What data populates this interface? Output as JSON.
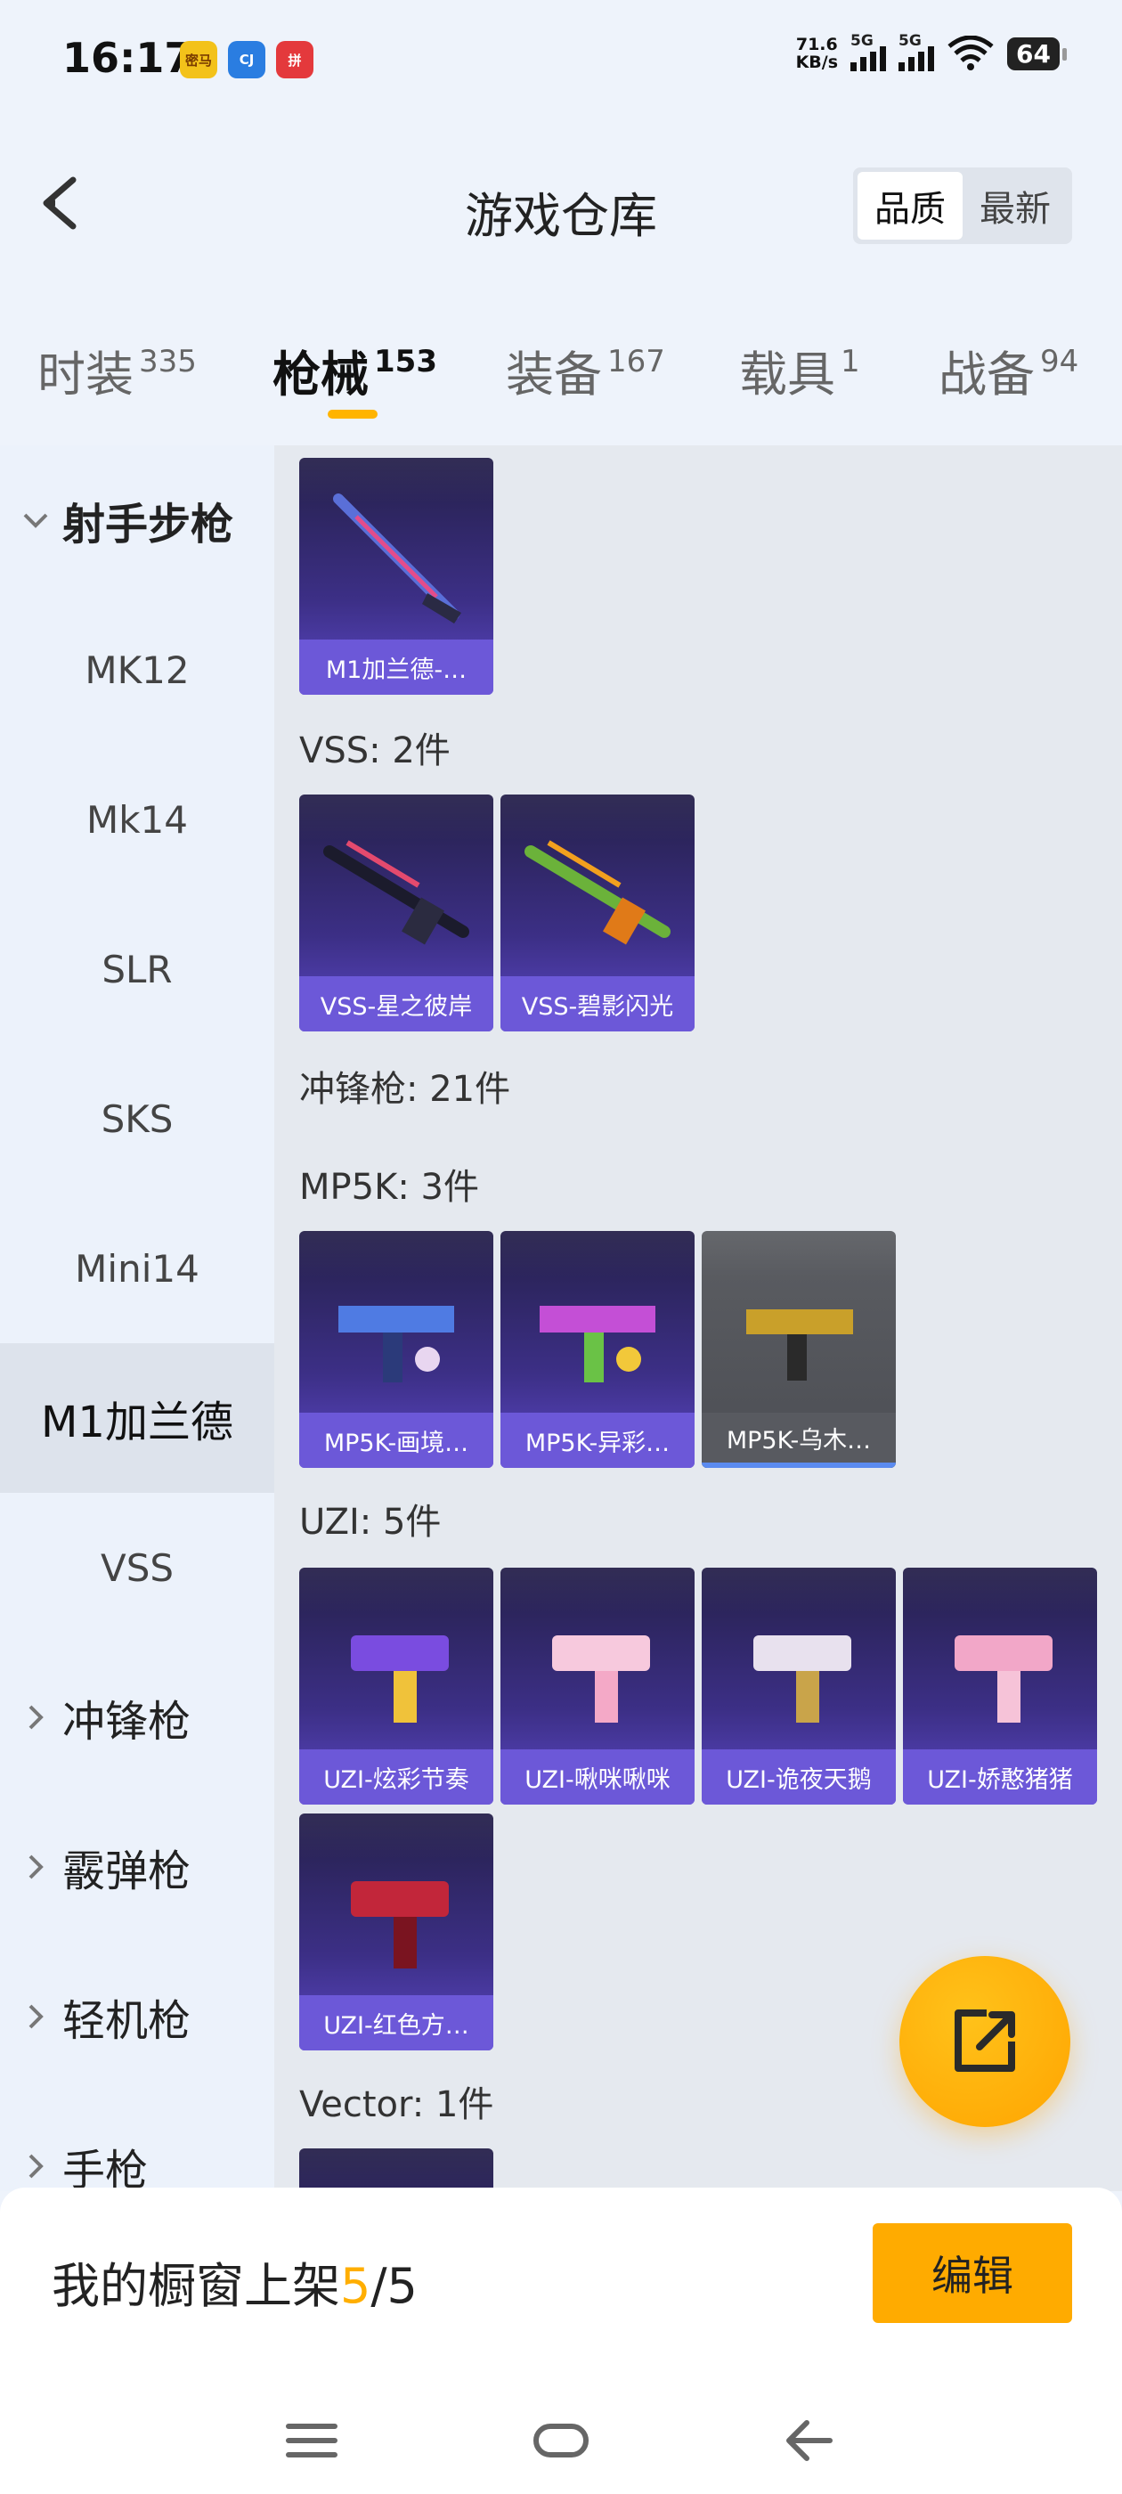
{
  "status_bar": {
    "time": "16:17",
    "apps": [
      {
        "icon": "app-icon-yellow",
        "label": "密马",
        "color": "#f3c21a"
      },
      {
        "icon": "app-icon-blue",
        "label": "CJ",
        "color": "#2a7de1"
      },
      {
        "icon": "app-icon-red",
        "label": "拼",
        "color": "#e4393c"
      }
    ],
    "net_speed": "71.6",
    "net_unit": "KB/s",
    "sig1": "5G",
    "sig2": "5G",
    "battery": "64"
  },
  "header": {
    "title": "游戏仓库",
    "sort_options": [
      "品质",
      "最新"
    ],
    "sort_active": "品质"
  },
  "tabs": [
    {
      "label": "时装",
      "count": "335"
    },
    {
      "label": "枪械",
      "count": "153",
      "active": true
    },
    {
      "label": "装备",
      "count": "167"
    },
    {
      "label": "载具",
      "count": "1"
    },
    {
      "label": "战备",
      "count": "94"
    }
  ],
  "sidebar": {
    "items": [
      {
        "label": "射手步枪",
        "type": "group",
        "open": true
      },
      {
        "label": "MK12"
      },
      {
        "label": "Mk14"
      },
      {
        "label": "SLR"
      },
      {
        "label": "SKS"
      },
      {
        "label": "Mini14"
      },
      {
        "label": "M1加兰德",
        "active": true
      },
      {
        "label": "VSS"
      },
      {
        "label": "冲锋枪",
        "type": "group"
      },
      {
        "label": "霰弹枪",
        "type": "group"
      },
      {
        "label": "轻机枪",
        "type": "group"
      },
      {
        "label": "手枪",
        "type": "group"
      }
    ]
  },
  "main": {
    "labels": {
      "vss": "VSS: 2件",
      "smg": "冲锋枪: 21件",
      "mp5k": "MP5K: 3件",
      "uzi": "UZI: 5件",
      "vector": "Vector: 1件"
    },
    "m1_items": [
      "M1加兰德-…"
    ],
    "vss_items": [
      "VSS-星之彼岸",
      "VSS-碧影闪光"
    ],
    "mp5k_items": [
      "MP5K-画境…",
      "MP5K-异彩…",
      "MP5K-乌木…"
    ],
    "uzi_items": [
      "UZI-炫彩节奏",
      "UZI-啾咪啾咪",
      "UZI-诡夜天鹅",
      "UZI-娇憨猪猪",
      "UZI-红色方…"
    ]
  },
  "bottom": {
    "shelf_prefix": "我的橱窗上架",
    "shelf_current": "5",
    "shelf_total": "/5",
    "edit_label": "编辑"
  },
  "colors": {
    "accent": "#ffab00",
    "card_purple": "#6c58d8",
    "card_gray": "#585a60"
  }
}
